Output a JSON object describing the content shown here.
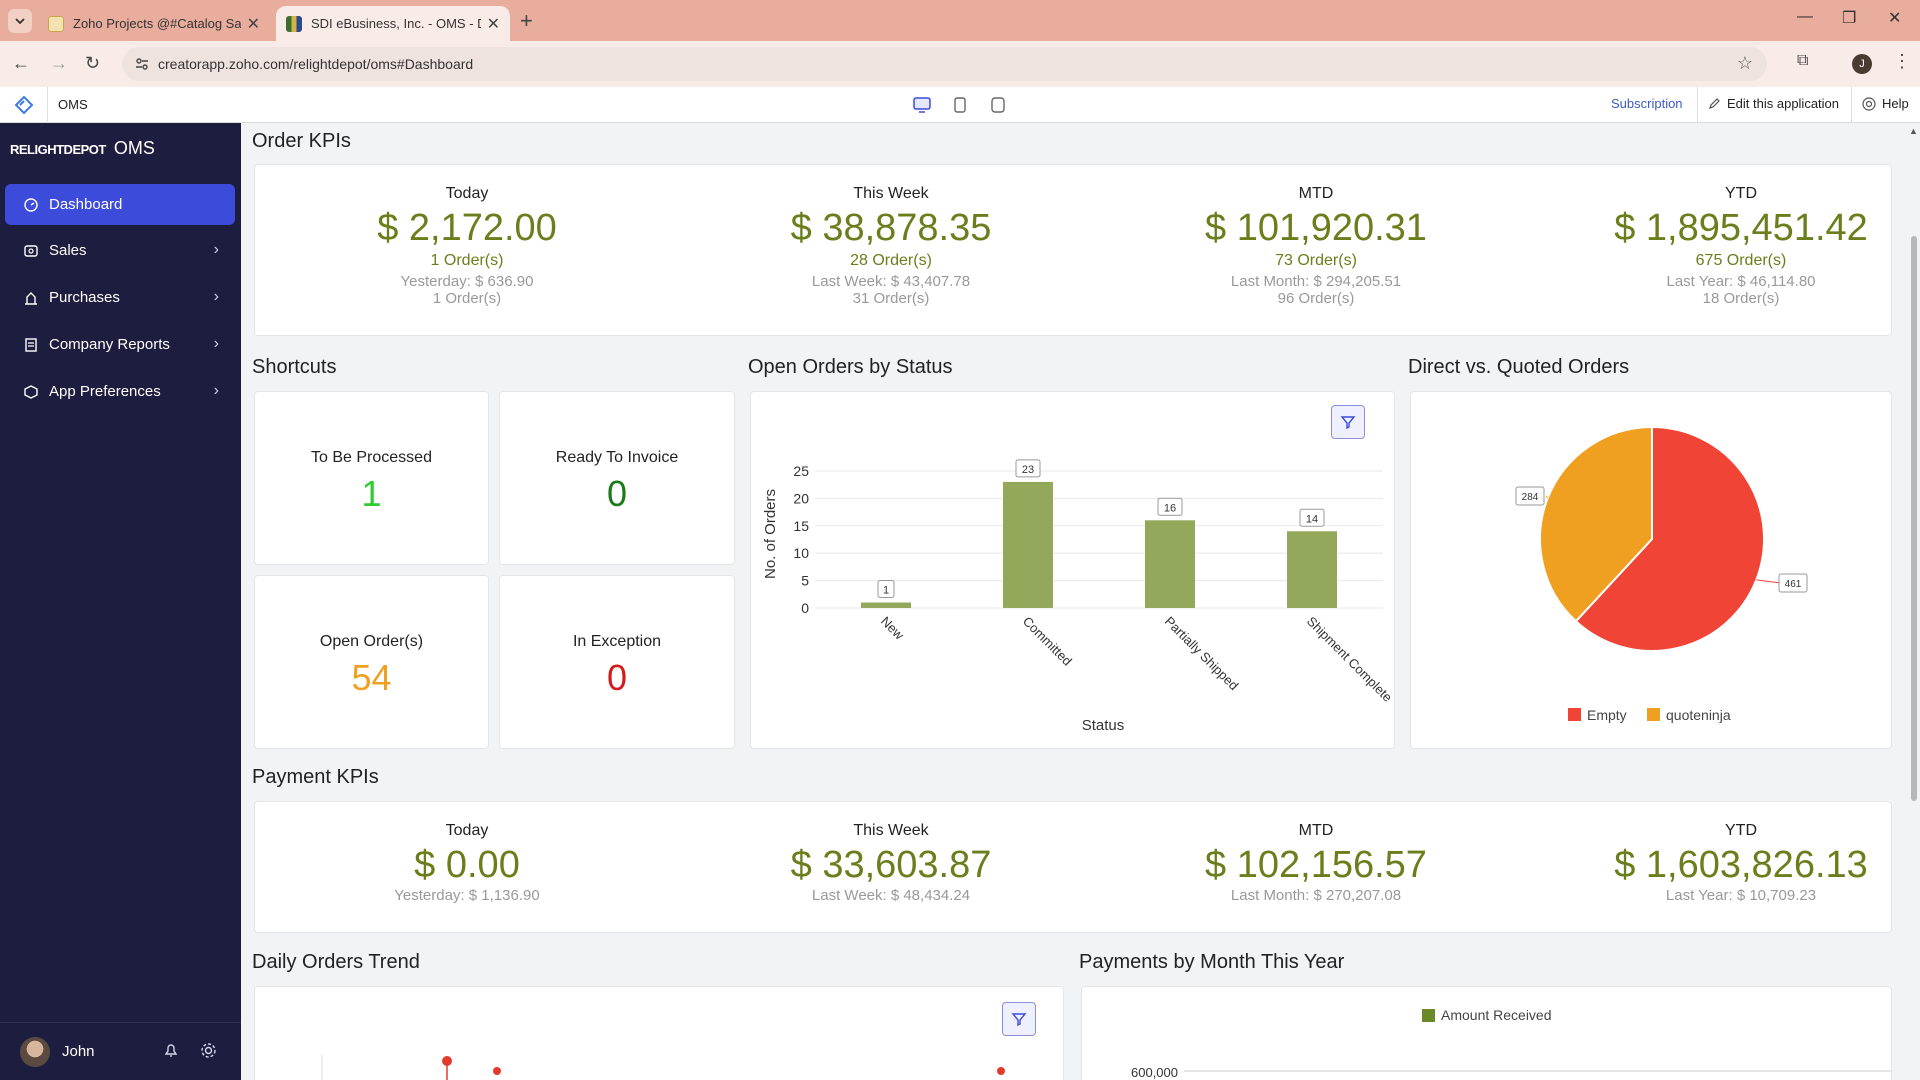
{
  "browser": {
    "tabs": [
      {
        "title": "Zoho Projects @#Catalog Says"
      },
      {
        "title": "SDI eBusiness, Inc. - OMS - Da"
      }
    ],
    "url": "creatorapp.zoho.com/relightdepot/oms#Dashboard",
    "profile_initial": "J"
  },
  "app_header": {
    "app_name": "OMS",
    "subscription": "Subscription",
    "edit": "Edit this application",
    "help": "Help"
  },
  "sidebar": {
    "brand_logo": "RELIGHTDEPOT",
    "brand_name": "OMS",
    "items": [
      {
        "label": "Dashboard",
        "icon": "dashboard-icon"
      },
      {
        "label": "Sales",
        "icon": "sales-icon"
      },
      {
        "label": "Purchases",
        "icon": "purchases-icon"
      },
      {
        "label": "Company Reports",
        "icon": "reports-icon"
      },
      {
        "label": "App Preferences",
        "icon": "preferences-icon"
      }
    ],
    "user": "John"
  },
  "order_kpis": {
    "title": "Order KPIs",
    "items": [
      {
        "label": "Today",
        "amount": "$ 2,172.00",
        "orders": "1 Order(s)",
        "prev": "Yesterday: $ 636.90",
        "prev_orders": "1 Order(s)"
      },
      {
        "label": "This Week",
        "amount": "$ 38,878.35",
        "orders": "28 Order(s)",
        "prev": "Last Week: $ 43,407.78",
        "prev_orders": "31 Order(s)"
      },
      {
        "label": "MTD",
        "amount": "$ 101,920.31",
        "orders": "73 Order(s)",
        "prev": "Last Month: $ 294,205.51",
        "prev_orders": "96 Order(s)"
      },
      {
        "label": "YTD",
        "amount": "$ 1,895,451.42",
        "orders": "675 Order(s)",
        "prev": "Last Year: $ 46,114.80",
        "prev_orders": "18 Order(s)"
      }
    ]
  },
  "shortcuts": {
    "title": "Shortcuts",
    "items": [
      {
        "label": "To Be Processed",
        "value": "1",
        "color": "#2ecc2e"
      },
      {
        "label": "Ready To Invoice",
        "value": "0",
        "color": "#1a7a1a"
      },
      {
        "label": "Open Order(s)",
        "value": "54",
        "color": "#f0a020"
      },
      {
        "label": "In Exception",
        "value": "0",
        "color": "#d01c1c"
      }
    ]
  },
  "open_orders": {
    "title": "Open Orders by Status"
  },
  "direct_quoted": {
    "title": "Direct vs. Quoted Orders"
  },
  "payment_kpis": {
    "title": "Payment KPIs",
    "items": [
      {
        "label": "Today",
        "amount": "$ 0.00",
        "prev": "Yesterday: $ 1,136.90"
      },
      {
        "label": "This Week",
        "amount": "$ 33,603.87",
        "prev": "Last Week: $ 48,434.24"
      },
      {
        "label": "MTD",
        "amount": "$ 102,156.57",
        "prev": "Last Month: $ 270,207.08"
      },
      {
        "label": "YTD",
        "amount": "$ 1,603,826.13",
        "prev": "Last Year: $ 10,709.23"
      }
    ]
  },
  "daily_orders": {
    "title": "Daily Orders Trend"
  },
  "payments_month": {
    "title": "Payments by Month This Year"
  },
  "chart_data": [
    {
      "type": "bar",
      "categories": [
        "New",
        "Committed",
        "Partially Shipped",
        "Shipment Complete"
      ],
      "values": [
        1,
        23,
        16,
        14
      ],
      "xlabel": "Status",
      "ylabel": "No. of Orders",
      "yticks": [
        0,
        5,
        10,
        15,
        20,
        25
      ],
      "ylim": [
        0,
        27
      ],
      "color": "#93a85a"
    },
    {
      "type": "pie",
      "categories": [
        "Empty",
        "quoteninja"
      ],
      "values": [
        461,
        284
      ],
      "colors": [
        "#ef4436",
        "#f0a020"
      ]
    },
    {
      "type": "bar",
      "series": [
        {
          "name": "Amount Received",
          "color": "#6a8a2a"
        }
      ],
      "yticks_visible": [
        "600,000"
      ]
    }
  ]
}
